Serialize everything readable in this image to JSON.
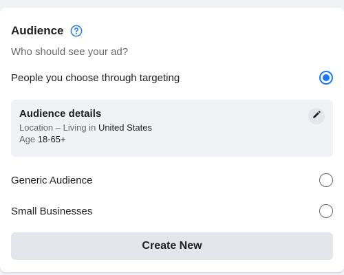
{
  "audience": {
    "title": "Audience",
    "help_icon": "question-circle-icon",
    "subtitle": "Who should see your ad?",
    "options": [
      {
        "label": "People you choose through targeting",
        "selected": true
      },
      {
        "label": "Generic Audience",
        "selected": false
      },
      {
        "label": "Small Businesses",
        "selected": false
      }
    ],
    "details": {
      "title": "Audience details",
      "location_prefix": "Location – Living in",
      "location_value": "United States",
      "age_prefix": "Age",
      "age_value": "18-65+",
      "edit_icon": "pencil-icon"
    },
    "create_button_label": "Create New"
  },
  "colors": {
    "accent": "#1877f2",
    "secondary_text": "#65676b",
    "panel_bg": "#f0f2f5",
    "button_bg": "#e4e6eb"
  }
}
